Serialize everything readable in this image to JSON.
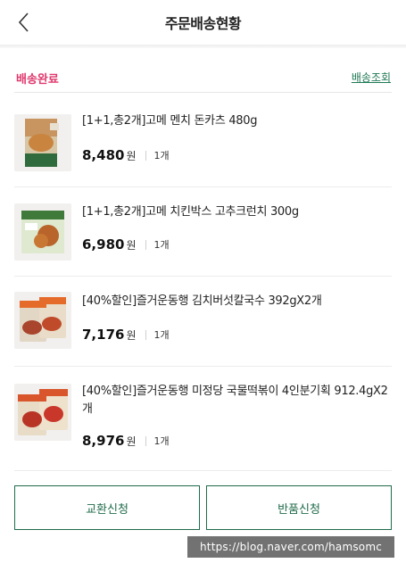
{
  "header": {
    "title": "주문배송현황",
    "back_icon": "chevron-left-icon"
  },
  "section": {
    "status": "배송완료",
    "track_link": "배송조회",
    "status_color": "#e0386d",
    "accent_color": "#1f6b4b"
  },
  "items": [
    {
      "name": "[1+1,총2개]고메 멘치 돈카츠 480g",
      "price": "8,480",
      "currency": "원",
      "qty": "1개"
    },
    {
      "name": "[1+1,총2개]고메 치킨박스 고추크런치 300g",
      "price": "6,980",
      "currency": "원",
      "qty": "1개"
    },
    {
      "name": "[40%할인]즐거운동행 김치버섯칼국수 392gX2개",
      "price": "7,176",
      "currency": "원",
      "qty": "1개"
    },
    {
      "name": "[40%할인]즐거운동행 미정당 국물떡볶이 4인분기획 912.4gX2개",
      "price": "8,976",
      "currency": "원",
      "qty": "1개"
    }
  ],
  "buttons": {
    "exchange": "교환신청",
    "return": "반품신청"
  },
  "watermark": "https://blog.naver.com/hamsomc"
}
